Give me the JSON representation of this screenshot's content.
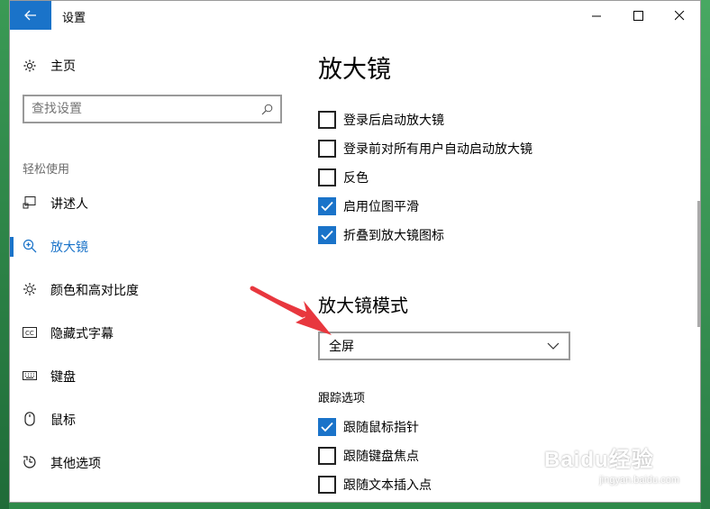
{
  "window": {
    "title": "设置",
    "controls": {
      "minimize": "minimize-icon",
      "maximize": "maximize-icon",
      "close": "close-icon"
    }
  },
  "sidebar": {
    "home_label": "主页",
    "search": {
      "placeholder": "查找设置"
    },
    "section": "轻松使用",
    "items": [
      {
        "label": "讲述人",
        "icon": "narrator-icon",
        "active": false
      },
      {
        "label": "放大镜",
        "icon": "magnifier-icon",
        "active": true
      },
      {
        "label": "颜色和高对比度",
        "icon": "brightness-icon",
        "active": false
      },
      {
        "label": "隐藏式字幕",
        "icon": "closed-caption-icon",
        "active": false
      },
      {
        "label": "键盘",
        "icon": "keyboard-icon",
        "active": false
      },
      {
        "label": "鼠标",
        "icon": "mouse-icon",
        "active": false
      },
      {
        "label": "其他选项",
        "icon": "other-options-icon",
        "active": false
      }
    ]
  },
  "content": {
    "title": "放大镜",
    "options": [
      {
        "label": "登录后启动放大镜",
        "checked": false
      },
      {
        "label": "登录前对所有用户自动启动放大镜",
        "checked": false
      },
      {
        "label": "反色",
        "checked": false
      },
      {
        "label": "启用位图平滑",
        "checked": true
      },
      {
        "label": "折叠到放大镜图标",
        "checked": true
      }
    ],
    "mode_heading": "放大镜模式",
    "mode_value": "全屏",
    "tracking_heading": "跟踪选项",
    "tracking": [
      {
        "label": "跟随鼠标指针",
        "checked": true
      },
      {
        "label": "跟随键盘焦点",
        "checked": false
      },
      {
        "label": "跟随文本插入点",
        "checked": false
      }
    ]
  },
  "watermark": {
    "brand": "Baidu经验",
    "sub": "jingyan.baidu.com"
  },
  "colors": {
    "accent": "#1a73c9",
    "arrow": "#e8373e"
  }
}
